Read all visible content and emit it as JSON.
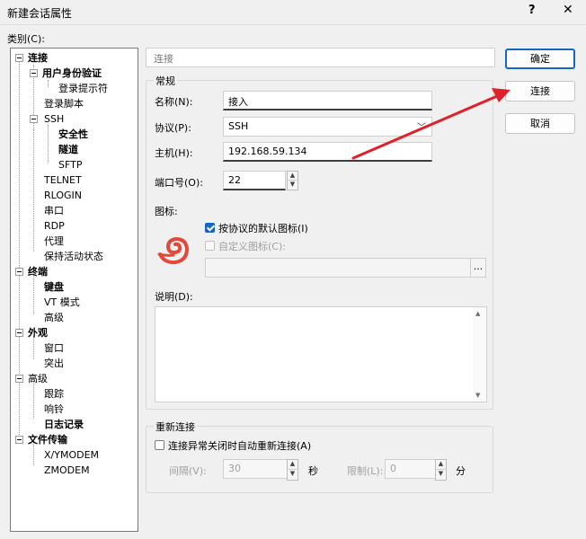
{
  "window": {
    "title": "新建会话属性",
    "help_glyph": "?",
    "close_glyph": "✕"
  },
  "category_label": "类别(C):",
  "tree": {
    "items": [
      {
        "label": "连接",
        "bold": true
      },
      {
        "label": "用户身份验证",
        "bold": true
      },
      {
        "label": "登录提示符",
        "bold": false
      },
      {
        "label": "登录脚本",
        "bold": false
      },
      {
        "label": "SSH",
        "bold": false
      },
      {
        "label": "安全性",
        "bold": true
      },
      {
        "label": "隧道",
        "bold": true
      },
      {
        "label": "SFTP",
        "bold": false
      },
      {
        "label": "TELNET",
        "bold": false
      },
      {
        "label": "RLOGIN",
        "bold": false
      },
      {
        "label": "串口",
        "bold": false
      },
      {
        "label": "RDP",
        "bold": false
      },
      {
        "label": "代理",
        "bold": false
      },
      {
        "label": "保持活动状态",
        "bold": false
      },
      {
        "label": "终端",
        "bold": true
      },
      {
        "label": "键盘",
        "bold": true
      },
      {
        "label": "VT 模式",
        "bold": false
      },
      {
        "label": "高级",
        "bold": false
      },
      {
        "label": "外观",
        "bold": true
      },
      {
        "label": "窗口",
        "bold": false
      },
      {
        "label": "突出",
        "bold": false
      },
      {
        "label": "高级",
        "bold": false
      },
      {
        "label": "跟踪",
        "bold": false
      },
      {
        "label": "响铃",
        "bold": false
      },
      {
        "label": "日志记录",
        "bold": true
      },
      {
        "label": "文件传输",
        "bold": true
      },
      {
        "label": "X/YMODEM",
        "bold": false
      },
      {
        "label": "ZMODEM",
        "bold": false
      }
    ]
  },
  "section_title": "连接",
  "general": {
    "group_title": "常规",
    "name_label": "名称(N):",
    "name_value": "接入",
    "protocol_label": "协议(P):",
    "protocol_value": "SSH",
    "host_label": "主机(H):",
    "host_value": "192.168.59.134",
    "port_label": "端口号(O):",
    "port_value": "22",
    "icon_label": "图标:",
    "default_icon_checkbox": "按协议的默认图标(I)",
    "default_icon_checked": true,
    "custom_icon_checkbox": "自定义图标(C):",
    "custom_icon_checked": false,
    "browse_label": "...",
    "description_label": "说明(D):"
  },
  "reconnect": {
    "group_title": "重新连接",
    "checkbox_label": "连接异常关闭时自动重新连接(A)",
    "checked": false,
    "interval_label": "间隔(V):",
    "interval_value": "30",
    "seconds_unit": "秒",
    "limit_label": "限制(L):",
    "limit_value": "0",
    "minutes_unit": "分"
  },
  "buttons": {
    "ok": "确定",
    "connect": "连接",
    "cancel": "取消"
  },
  "colors": {
    "accent": "#1765c1",
    "arrow": "#e0202a",
    "protocol_icon": "#e04a3a"
  }
}
